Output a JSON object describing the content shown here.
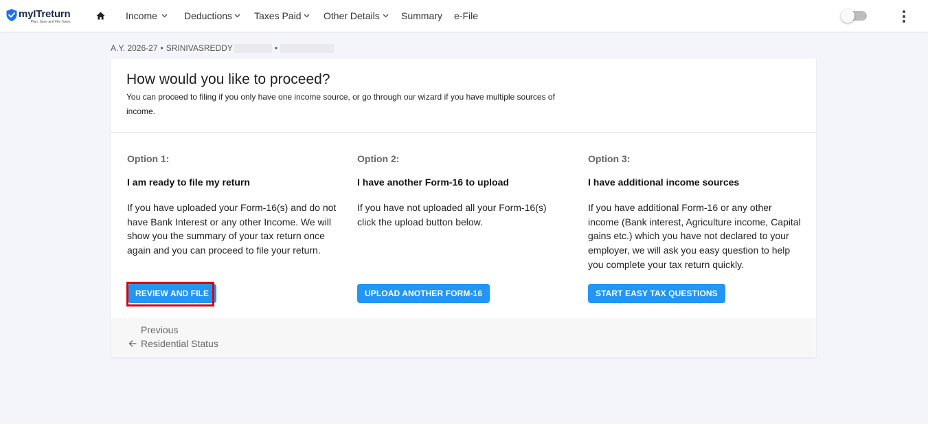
{
  "header": {
    "logo_name": "myITreturn",
    "logo_tagline": "Plan, Save and File Taxes",
    "nav": [
      {
        "label": "Income",
        "has_dropdown": true
      },
      {
        "label": "Deductions",
        "has_dropdown": true
      },
      {
        "label": "Taxes Paid",
        "has_dropdown": true
      },
      {
        "label": "Other Details",
        "has_dropdown": true
      },
      {
        "label": "Summary",
        "has_dropdown": false
      },
      {
        "label": "e-File",
        "has_dropdown": false
      }
    ],
    "icons": {
      "home": "home-icon",
      "more": "more-vert-icon",
      "toggle": "theme-toggle"
    },
    "toggle_on": false
  },
  "breadcrumb": {
    "assessment_year": "A.Y. 2026-27",
    "separator": "•",
    "user_name": "SRINIVASREDDY"
  },
  "card": {
    "title": "How would you like to proceed?",
    "subtitle": "You can proceed to filing if you only have one income source, or go through our wizard if you have multiple sources of income.",
    "options": [
      {
        "number": "Option 1:",
        "heading": "I am ready to file my return",
        "description": "If you have uploaded your Form-16(s) and do not have Bank Interest or any other Income. We will show you the summary of your tax return once again and you can proceed to file your return.",
        "button": "REVIEW AND FILE"
      },
      {
        "number": "Option 2:",
        "heading": "I have another Form-16 to upload",
        "description": "If you have not uploaded all your Form-16(s) click the upload button below.",
        "button": "UPLOAD ANOTHER FORM-16"
      },
      {
        "number": "Option 3:",
        "heading": "I have additional income sources",
        "description": "If you have additional Form-16 or any other income (Bank interest, Agriculture income, Capital gains etc.) which you have not declared to your employer, we will ask you easy question to help you complete your tax return quickly.",
        "button": "START EASY TAX QUESTIONS"
      }
    ],
    "footer": {
      "previous_label": "Previous",
      "previous_link": "Residential Status"
    }
  },
  "colors": {
    "accent": "#2196f3",
    "highlight_border": "#e00000",
    "page_background": "#f4f5fa",
    "logo_shield": "#1e6ff0"
  }
}
